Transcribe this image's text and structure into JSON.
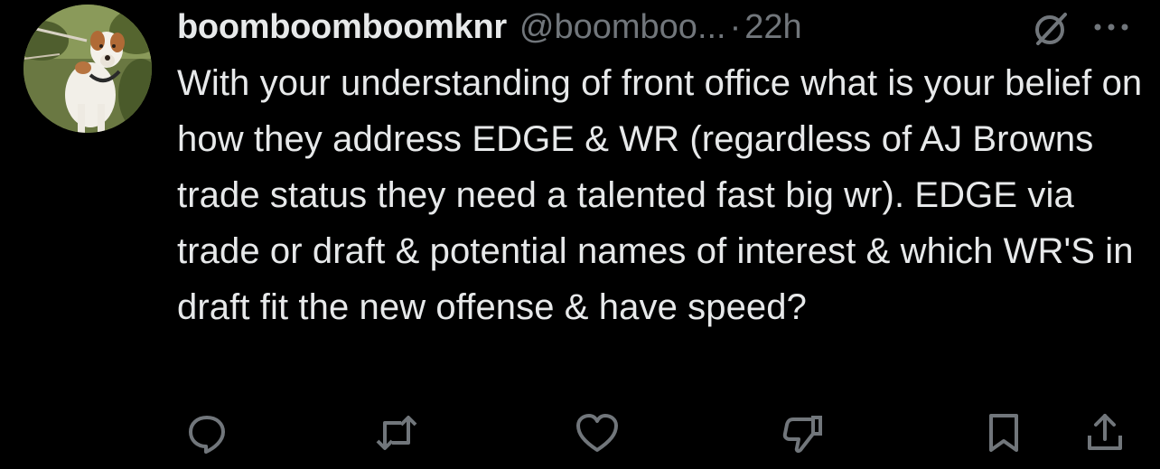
{
  "tweet": {
    "display_name": "boomboomboomknr",
    "handle": "@boomboo...",
    "separator": "·",
    "time": "22h",
    "text": "With your understanding of front office what is your belief on how they address EDGE & WR (regardless of AJ Browns trade status they need a talented fast big wr). EDGE via trade or draft & potential names of interest & which WR'S in draft fit the new offense & have speed?"
  },
  "icons": {
    "avatar": "dog-avatar",
    "grok": "grok-icon",
    "more": "more-icon",
    "reply": "reply-icon",
    "repost": "repost-icon",
    "like": "like-icon",
    "dislike": "dislike-icon",
    "bookmark": "bookmark-icon",
    "share": "share-icon"
  },
  "colors": {
    "background": "#000000",
    "primary_text": "#e7e9ea",
    "secondary_text": "#71767b"
  }
}
